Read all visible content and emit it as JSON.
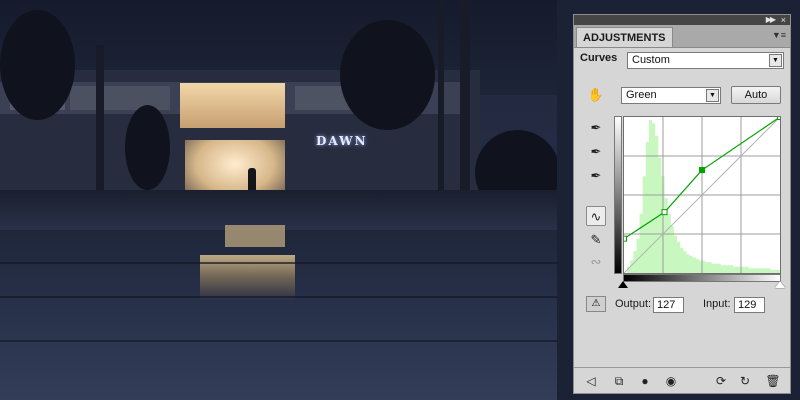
{
  "panel": {
    "tab_label": "ADJUSTMENTS",
    "collapse_icon": "double-chevron-right-icon",
    "close_icon": "close-icon",
    "menu_icon": "panel-menu-icon",
    "section_label": "Curves",
    "preset_value": "Custom",
    "channel_value": "Green",
    "auto_label": "Auto",
    "output_label": "Output:",
    "output_value": "127",
    "input_label": "Input:",
    "input_value": "129"
  },
  "tools": {
    "on_image_adjust": "hand-adjust-icon",
    "black_point": "eyedropper-black-icon",
    "gray_point": "eyedropper-gray-icon",
    "white_point": "eyedropper-white-icon",
    "curve_mode": "curve-points-icon",
    "pencil_mode": "pencil-icon",
    "smooth": "smooth-curve-icon",
    "clipping_warning": "clipping-warning-icon"
  },
  "footer_icons": [
    "back-arrow-icon",
    "expanded-view-icon",
    "clip-to-layer-icon",
    "visibility-eye-icon",
    "previous-state-icon",
    "reset-icon",
    "trash-icon"
  ],
  "colors": {
    "curve": "#00a300",
    "histogram": "#c8f7c0",
    "panel_bg": "#d6d6d6",
    "photo_sign": "#e6ecff"
  },
  "photo": {
    "sign_text": "DAWN"
  },
  "curve_points": [
    [
      0,
      22
    ],
    [
      26,
      39
    ],
    [
      50,
      66
    ],
    [
      100,
      100
    ]
  ],
  "histogram": [
    0,
    4,
    8,
    14,
    22,
    38,
    62,
    84,
    98,
    96,
    88,
    74,
    62,
    48,
    38,
    30,
    24,
    20,
    16,
    14,
    12,
    11,
    10,
    9,
    8,
    8,
    7,
    7,
    6,
    6,
    6,
    5,
    5,
    5,
    5,
    4,
    4,
    4,
    4,
    4,
    3,
    3,
    3,
    3,
    3,
    3,
    3,
    2,
    2,
    2
  ]
}
